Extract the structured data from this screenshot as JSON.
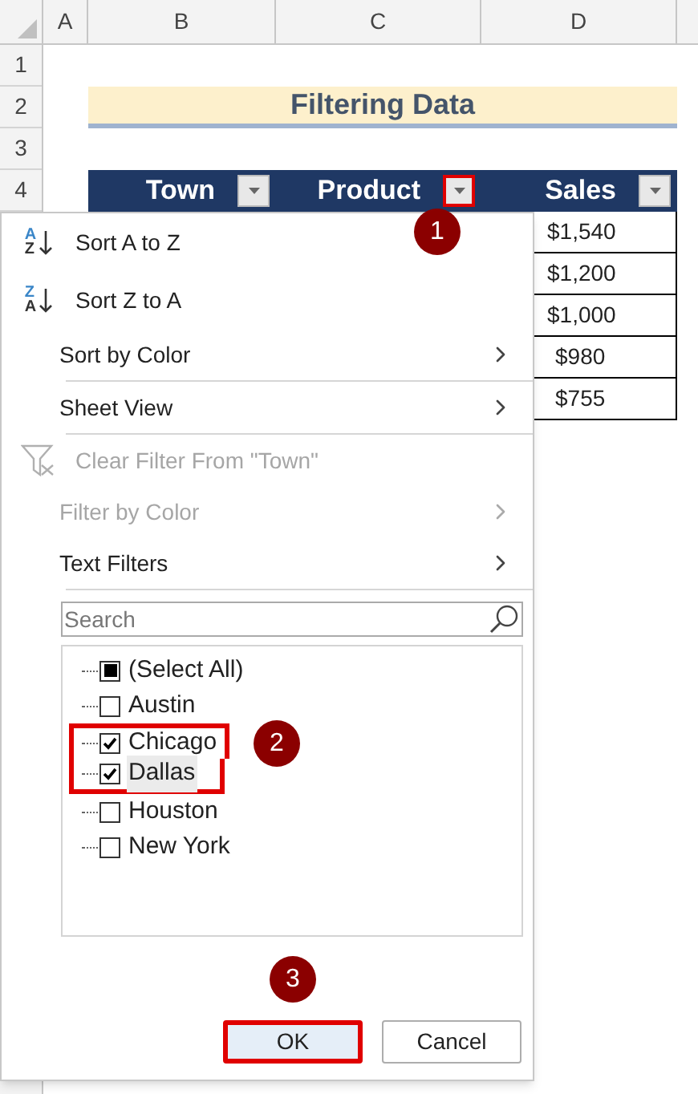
{
  "column_headers": [
    "A",
    "B",
    "C",
    "D"
  ],
  "row_headers": [
    "1",
    "2",
    "3",
    "4"
  ],
  "title": "Filtering Data",
  "table": {
    "columns": [
      {
        "label": "Town",
        "highlighted": false
      },
      {
        "label": "Product",
        "highlighted": true
      },
      {
        "label": "Sales",
        "highlighted": false
      }
    ],
    "sales": [
      "$1,540",
      "$1,200",
      "$1,000",
      "$980",
      "$755"
    ]
  },
  "menu": {
    "items": [
      {
        "kind": "sort",
        "label": "Sort A to Z",
        "icon_text": [
          "A",
          "Z"
        ],
        "disabled": false,
        "divider_after": false
      },
      {
        "kind": "sort",
        "label": "Sort Z to A",
        "icon_text": [
          "Z",
          "A"
        ],
        "disabled": false,
        "divider_after": false
      },
      {
        "kind": "submenu",
        "label": "Sort by Color",
        "disabled": false,
        "divider_after": true
      },
      {
        "kind": "submenu",
        "label": "Sheet View",
        "disabled": false,
        "divider_after": true
      },
      {
        "kind": "clear",
        "label": "Clear Filter From \"Town\"",
        "disabled": true,
        "divider_after": false
      },
      {
        "kind": "submenu",
        "label": "Filter by Color",
        "disabled": true,
        "divider_after": false
      },
      {
        "kind": "submenu",
        "label": "Text Filters",
        "disabled": false,
        "divider_after": true
      }
    ],
    "search": {
      "placeholder": "Search"
    },
    "filter_list": [
      {
        "label": "(Select All)",
        "checked": false,
        "mixed": true,
        "highlighted": false,
        "hovered": false
      },
      {
        "label": "Austin",
        "checked": false,
        "mixed": false,
        "highlighted": false,
        "hovered": false
      },
      {
        "label": "Chicago",
        "checked": true,
        "mixed": false,
        "highlighted": true,
        "hovered": false
      },
      {
        "label": "Dallas",
        "checked": true,
        "mixed": false,
        "highlighted": true,
        "hovered": true
      },
      {
        "label": "Houston",
        "checked": false,
        "mixed": false,
        "highlighted": false,
        "hovered": false
      },
      {
        "label": "New York",
        "checked": false,
        "mixed": false,
        "highlighted": false,
        "hovered": false
      }
    ],
    "buttons": [
      {
        "label": "OK",
        "highlighted": true
      },
      {
        "label": "Cancel",
        "highlighted": false
      }
    ]
  },
  "callouts": [
    "1",
    "2",
    "3"
  ]
}
